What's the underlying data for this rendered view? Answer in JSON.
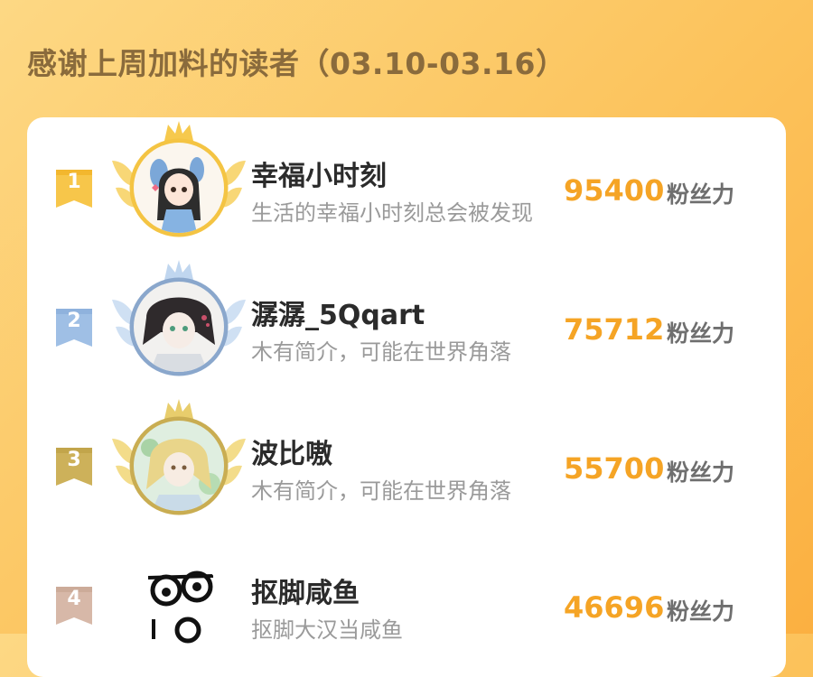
{
  "header": {
    "title": "感谢上周加料的读者（03.10-03.16）"
  },
  "colors": {
    "background_start": "#fdd884",
    "background_end": "#fbb041",
    "title": "#8a6b3c",
    "score": "#f5a425",
    "rank_gold": "#f7c64a",
    "rank_silver": "#9fbfe5",
    "rank_bronze": "#cdb15a",
    "rank_plain": "#d7b8a8"
  },
  "score_unit": "粉丝力",
  "readers": [
    {
      "rank": "1",
      "name": "幸福小时刻",
      "bio": "生活的幸福小时刻总会被发现",
      "score": "95400",
      "avatar_icon": "cartoon-girl-avatar-icon",
      "crown_icon": "gold-crown-icon"
    },
    {
      "rank": "2",
      "name": "潺潺_5Qqart",
      "bio": "木有简介，可能在世界角落",
      "score": "75712",
      "avatar_icon": "anime-boy-avatar-icon",
      "crown_icon": "silver-crown-icon"
    },
    {
      "rank": "3",
      "name": "波比嗷",
      "bio": "木有简介，可能在世界角落",
      "score": "55700",
      "avatar_icon": "blond-anime-avatar-icon",
      "crown_icon": "bronze-crown-icon"
    },
    {
      "rank": "4",
      "name": "抠脚咸鱼",
      "bio": "抠脚大汉当咸鱼",
      "score": "46696",
      "avatar_icon": "doodle-face-avatar-icon",
      "crown_icon": ""
    }
  ]
}
